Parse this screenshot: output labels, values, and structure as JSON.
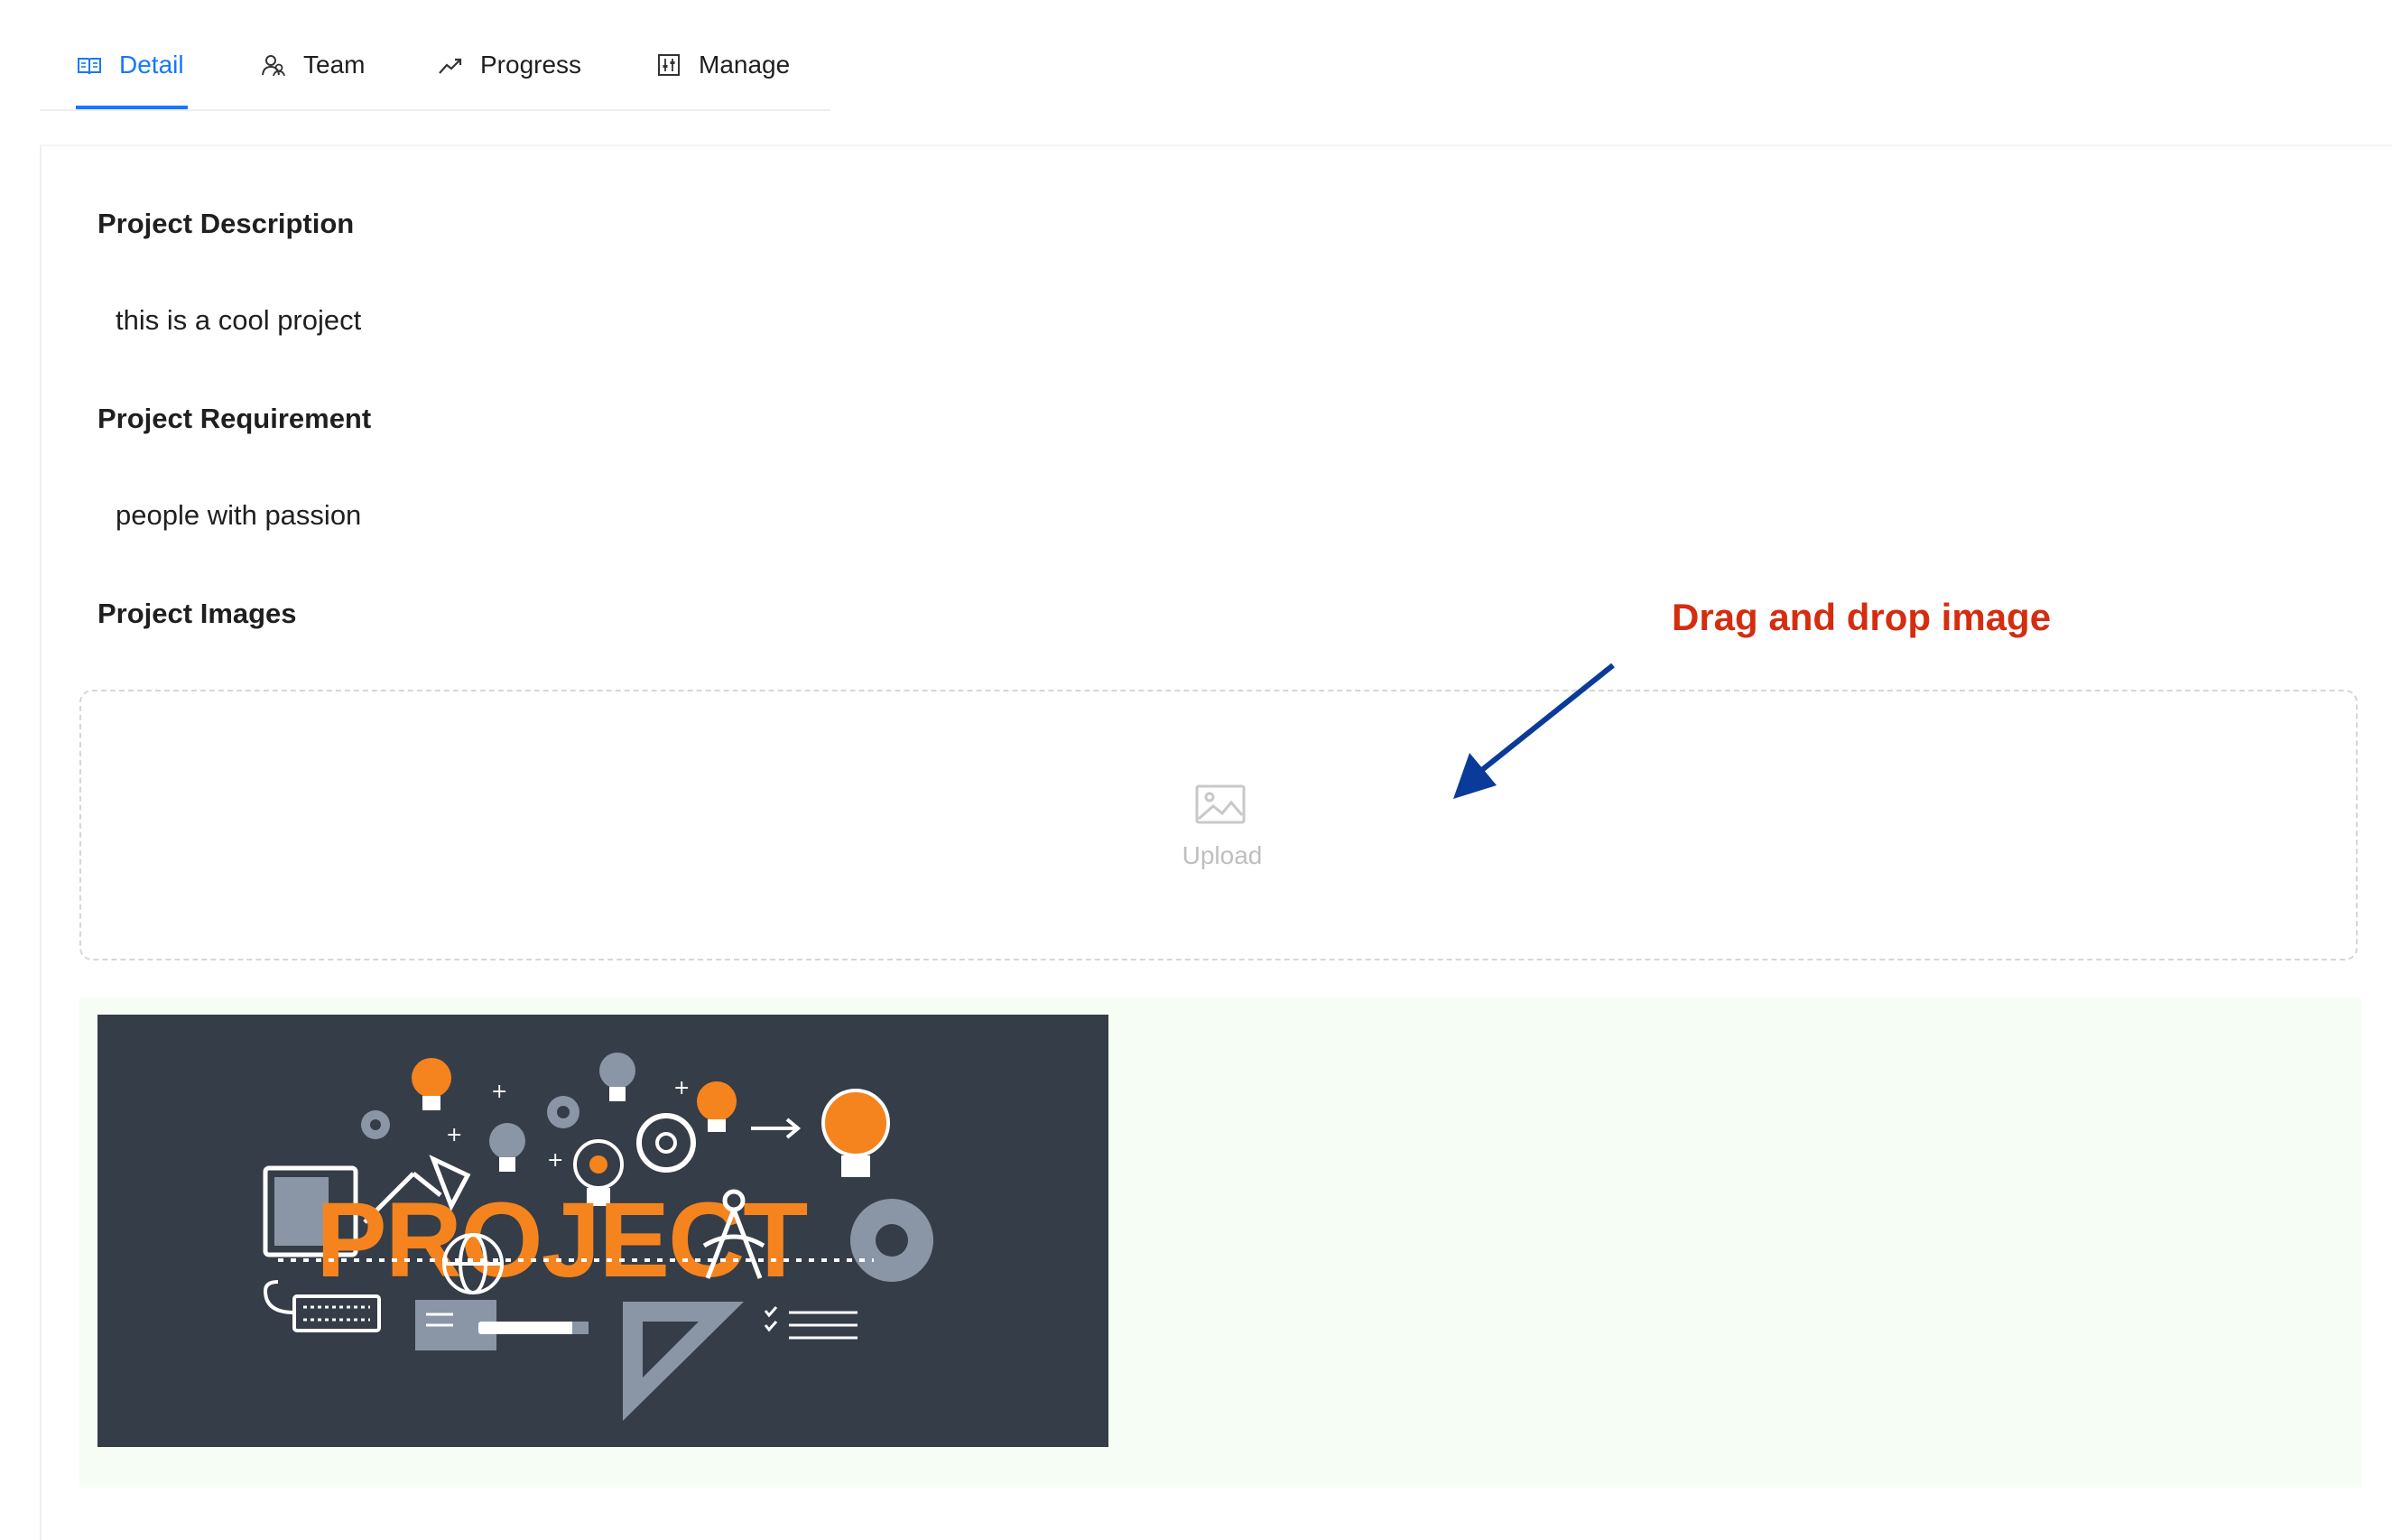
{
  "tabs": [
    {
      "label": "Detail",
      "icon": "book-icon",
      "active": true
    },
    {
      "label": "Team",
      "icon": "team-icon",
      "active": false
    },
    {
      "label": "Progress",
      "icon": "trend-icon",
      "active": false
    },
    {
      "label": "Manage",
      "icon": "sliders-icon",
      "active": false
    }
  ],
  "detail": {
    "description_heading": "Project Description",
    "description_text": "this is a cool project",
    "requirement_heading": "Project Requirement",
    "requirement_text": "people with passion",
    "images_heading": "Project Images"
  },
  "upload": {
    "label": "Upload",
    "icon": "image-icon"
  },
  "gallery": {
    "images": [
      {
        "banner_text": "PROJECT"
      }
    ]
  },
  "annotation": {
    "text": "Drag and drop image",
    "color": "#d42d10",
    "arrow_color": "#0a3a9a"
  },
  "colors": {
    "accent": "#1677ff",
    "gallery_bg": "#f6fdf5",
    "thumb_bg": "#353d48",
    "orange": "#f5841f"
  }
}
